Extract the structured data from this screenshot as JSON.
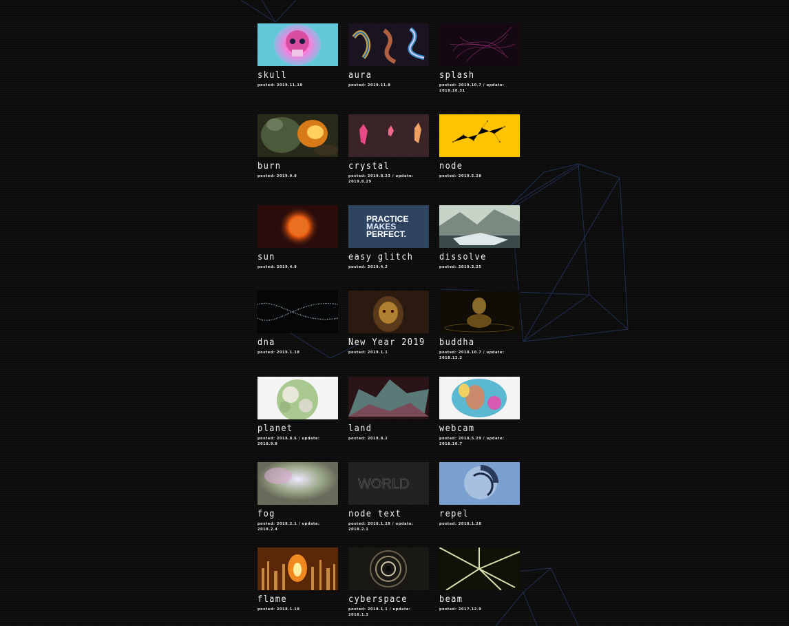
{
  "works": [
    {
      "title": "skull",
      "meta": "posted: 2019.11.18",
      "thumb": "skull"
    },
    {
      "title": "aura",
      "meta": "posted: 2019.11.8",
      "thumb": "aura"
    },
    {
      "title": "splash",
      "meta": "posted: 2019.10.7 / update: 2019.10.31",
      "thumb": "splash"
    },
    {
      "title": "burn",
      "meta": "posted: 2019.9.8",
      "thumb": "burn"
    },
    {
      "title": "crystal",
      "meta": "posted: 2019.8.23 / update: 2019.8.29",
      "thumb": "crystal"
    },
    {
      "title": "node",
      "meta": "posted: 2019.5.28",
      "thumb": "node"
    },
    {
      "title": "sun",
      "meta": "posted: 2019.4.8",
      "thumb": "sun"
    },
    {
      "title": "easy glitch",
      "meta": "posted: 2019.4.2",
      "thumb": "glitch",
      "thumb_text": [
        "PRACTICE",
        "MAKES",
        "PERFECT."
      ]
    },
    {
      "title": "dissolve",
      "meta": "posted: 2019.3.25",
      "thumb": "dissolve"
    },
    {
      "title": "dna",
      "meta": "posted: 2019.1.18",
      "thumb": "dna"
    },
    {
      "title": "New Year 2019",
      "meta": "posted: 2019.1.1",
      "thumb": "newyear"
    },
    {
      "title": "buddha",
      "meta": "posted: 2018.10.7 / update: 2018.12.2",
      "thumb": "buddha"
    },
    {
      "title": "planet",
      "meta": "posted: 2018.8.6 / update: 2018.9.8",
      "thumb": "planet"
    },
    {
      "title": "land",
      "meta": "posted: 2018.8.2",
      "thumb": "land"
    },
    {
      "title": "webcam",
      "meta": "posted: 2018.5.29 / update: 2018.10.7",
      "thumb": "webcam"
    },
    {
      "title": "fog",
      "meta": "posted: 2018.2.1 / update: 2018.2.4",
      "thumb": "fog"
    },
    {
      "title": "node text",
      "meta": "posted: 2018.1.29 / update: 2018.2.1",
      "thumb": "nodetext",
      "thumb_text": [
        "WORLD"
      ]
    },
    {
      "title": "repel",
      "meta": "posted: 2018.1.28",
      "thumb": "repel"
    },
    {
      "title": "flame",
      "meta": "posted: 2018.1.18",
      "thumb": "flame"
    },
    {
      "title": "cyberspace",
      "meta": "posted: 2018.1.1 / update: 2018.1.3",
      "thumb": "cyberspace"
    },
    {
      "title": "beam",
      "meta": "posted: 2017.12.9",
      "thumb": "beam"
    }
  ],
  "colors": {
    "background": "#0b0b0c",
    "text": "#f2f2f2",
    "wireframe": "#2a3a66"
  }
}
